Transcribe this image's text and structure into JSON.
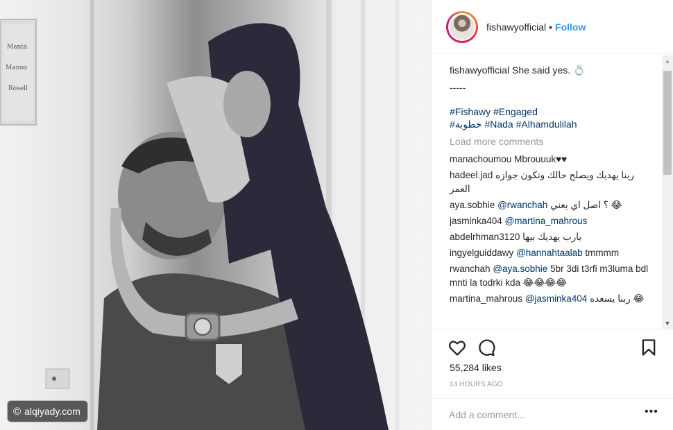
{
  "photo": {
    "alt": "",
    "watermark": {
      "icon": "copyright-icon",
      "text": "alqiyady.com"
    }
  },
  "header": {
    "username": "fishawyofficial",
    "separator": "•",
    "follow_label": "Follow"
  },
  "caption": {
    "username": "fishawyofficial",
    "text": "She said yes. 💍",
    "dashes": "-----",
    "tags_line1": "#Fishawy #Engaged",
    "tags_line2": "#خطوبة #Nada #Alhamdulilah"
  },
  "load_more": "Load more comments",
  "comments": [
    {
      "user": "manachoumou",
      "mention": "",
      "text": "Mbrouuuk♥♥"
    },
    {
      "user": "hadeel.jad",
      "mention": "",
      "text": "ربنا يهديك ويصلح حالك وتكون جوازه العمر"
    },
    {
      "user": "aya.sobhie",
      "mention": "@rwanchah",
      "text": "؟ اصل اي يعني 😂"
    },
    {
      "user": "jasminka404",
      "mention": "@martina_mahrous",
      "text": ""
    },
    {
      "user": "abdelrhman3120",
      "mention": "",
      "text": "يارب يهديك بيها"
    },
    {
      "user": "ingyelguiddawy",
      "mention": "@hannahtaalab",
      "text": "tmmmm"
    },
    {
      "user": "rwanchah",
      "mention": "@aya.sobhie",
      "text": "5br 3di t3rfi m3luma bdl mnti la todrki kda 😂😂😂😂"
    },
    {
      "user": "martina_mahrous",
      "mention": "@jasminka404",
      "text": "ربنا يسعده 😂"
    }
  ],
  "actions": {
    "like_icon": "heart-icon",
    "comment_icon": "comment-icon",
    "save_icon": "bookmark-icon"
  },
  "likes": "55,284 likes",
  "timestamp": "14 HOURS AGO",
  "add_comment": {
    "placeholder": "Add a comment...",
    "more_label": "•••"
  },
  "colors": {
    "link": "#3897f0",
    "hashtag": "#003569",
    "muted": "#999999",
    "border": "#efefef"
  }
}
